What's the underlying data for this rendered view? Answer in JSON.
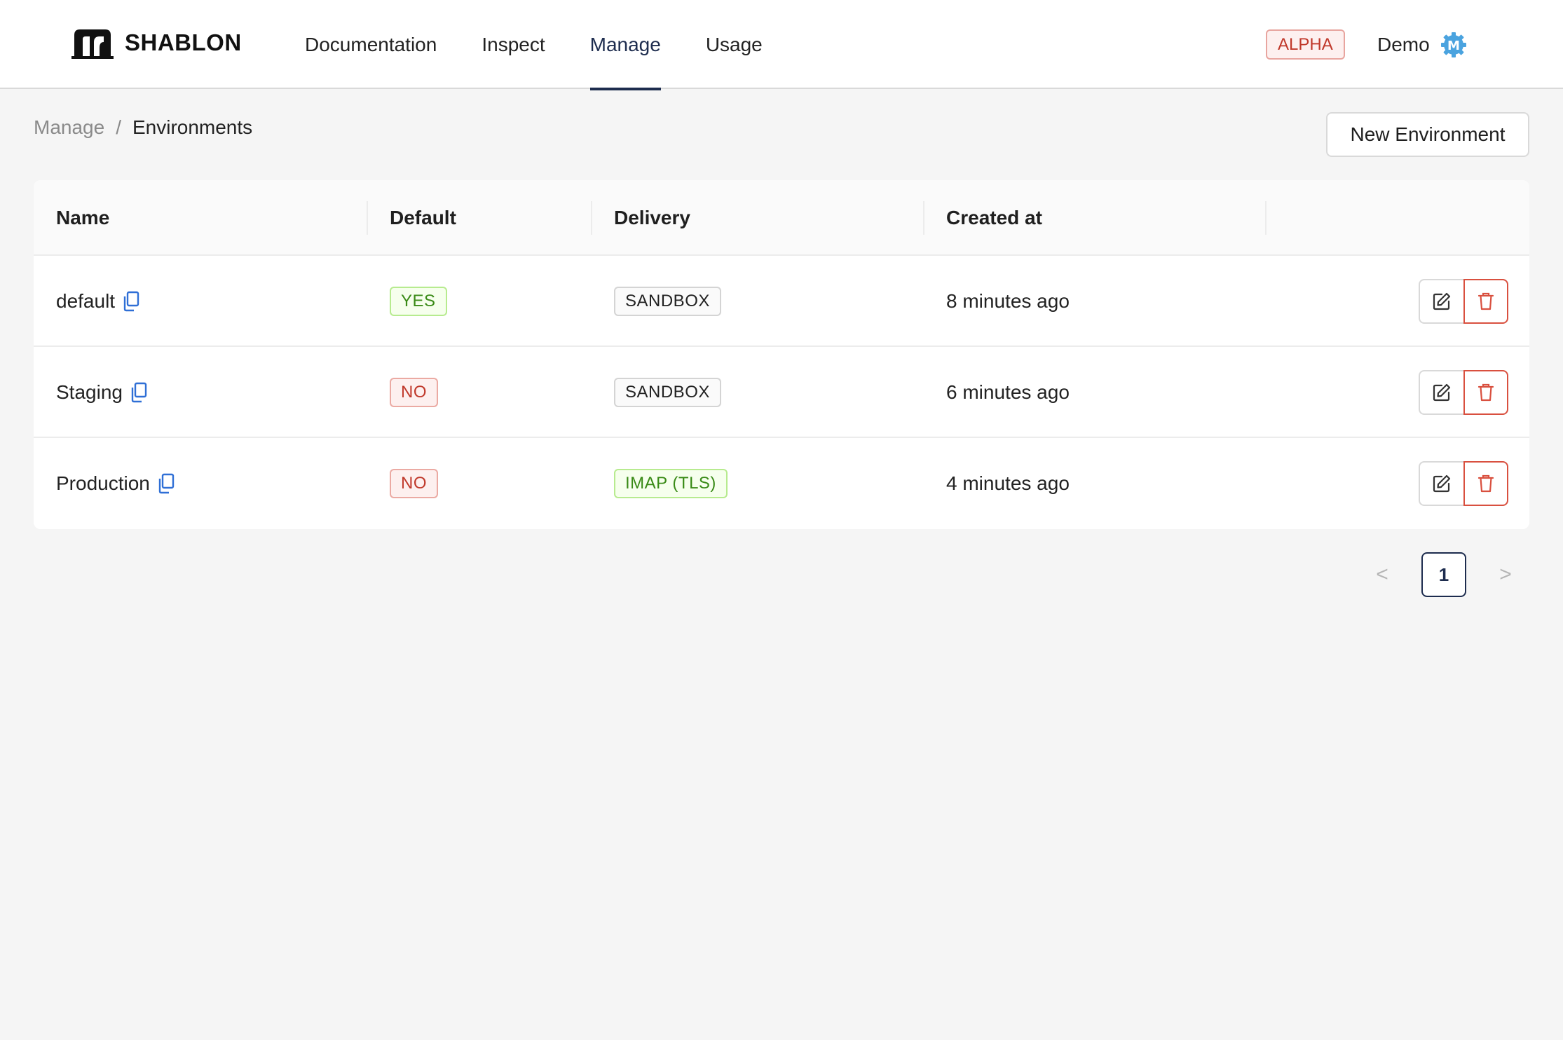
{
  "header": {
    "brand": "SHABLON",
    "nav": [
      {
        "label": "Documentation",
        "active": false
      },
      {
        "label": "Inspect",
        "active": false
      },
      {
        "label": "Manage",
        "active": true
      },
      {
        "label": "Usage",
        "active": false
      }
    ],
    "badge": "ALPHA",
    "user_name": "Demo",
    "avatar_letter": "M"
  },
  "breadcrumb": {
    "parent": "Manage",
    "separator": "/",
    "current": "Environments"
  },
  "actions": {
    "new_environment": "New Environment"
  },
  "table": {
    "columns": [
      "Name",
      "Default",
      "Delivery",
      "Created at"
    ],
    "rows": [
      {
        "name": "default",
        "default": "YES",
        "default_tone": "green",
        "delivery": "SANDBOX",
        "delivery_tone": "gray",
        "created_at": "8 minutes ago"
      },
      {
        "name": "Staging",
        "default": "NO",
        "default_tone": "red",
        "delivery": "SANDBOX",
        "delivery_tone": "gray",
        "created_at": "6 minutes ago"
      },
      {
        "name": "Production",
        "default": "NO",
        "default_tone": "red",
        "delivery": "IMAP (TLS)",
        "delivery_tone": "green",
        "created_at": "4 minutes ago"
      }
    ]
  },
  "pagination": {
    "prev": "<",
    "current": "1",
    "next": ">"
  },
  "colors": {
    "primary": "#1d2c4e",
    "danger": "#d9503f",
    "success": "#3a8b17",
    "copy_icon": "#2f6fd6",
    "avatar": "#4aa3df"
  },
  "icons": {
    "copy": "copy-icon",
    "edit": "edit-icon",
    "delete": "trash-icon",
    "settings": "gear-icon"
  }
}
